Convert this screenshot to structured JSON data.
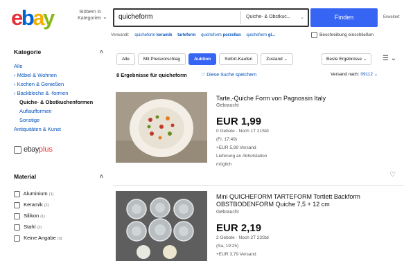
{
  "header": {
    "shop_by": "Stöbern in Kategorien",
    "search_value": "quicheform",
    "category_select": "Quiche- & Obstkuc...",
    "search_button": "Finden",
    "advanced": "Erweitert"
  },
  "related": {
    "prefix": "Verwandt:",
    "items": [
      {
        "pre": "quicheform ",
        "bold": "keramik"
      },
      {
        "pre": "",
        "bold": "tarteform"
      },
      {
        "pre": "quicheform ",
        "bold": "porzellan"
      },
      {
        "pre": "quicheform ",
        "bold": "gl..."
      }
    ],
    "desc_checkbox": "Beschreibung einschließen"
  },
  "sidebar": {
    "category_heading": "Kategorie",
    "categories": [
      {
        "label": "Alle",
        "kind": "link"
      },
      {
        "label": "‹ Möbel & Wohnen",
        "kind": "link"
      },
      {
        "label": "‹ Kochen & Genießen",
        "kind": "link"
      },
      {
        "label": "‹ Backbleche & -formen",
        "kind": "link"
      },
      {
        "label": "Quiche- & Obstkuchenformen",
        "kind": "current"
      },
      {
        "label": "Auflaufformen",
        "kind": "sub"
      },
      {
        "label": "Sonstige",
        "kind": "sub"
      },
      {
        "label": "Antiquitäten & Kunst",
        "kind": "link"
      }
    ],
    "ebayplus_e": "ebay",
    "ebayplus_p": "plus",
    "material_heading": "Material",
    "materials": [
      {
        "label": "Aluminium",
        "count": "(1)"
      },
      {
        "label": "Keramik",
        "count": "(2)"
      },
      {
        "label": "Silikon",
        "count": "(1)"
      },
      {
        "label": "Stahl",
        "count": "(2)"
      },
      {
        "label": "Keine Angabe",
        "count": "(3)"
      }
    ]
  },
  "toolbar": {
    "tabs": [
      "Alle",
      "Mit Preisvorschlag",
      "Auktion",
      "Sofort-Kaufen",
      "Zustand ⌄"
    ],
    "active_tab": "Auktion",
    "sort": "Beste Ergebnisse ⌄",
    "view": "☰ ⌄"
  },
  "results": {
    "count_text": "8 Ergebnisse für ",
    "query": "quicheform",
    "save_search": "Diese Suche speichern",
    "ship_to_label": "Versand nach: ",
    "ship_to_loc": "09112 ⌄"
  },
  "items": [
    {
      "title": "Tarte,-Quiche Form von Pagnossin Italy",
      "condition": "Gebraucht",
      "price": "EUR 1,99",
      "bids": "0 Gebote · Noch 1T 21Std",
      "end": "(Fr, 17:49)",
      "shipping": "+EUR 5,99 Versand",
      "pickup1": "Lieferung an Abholstation",
      "pickup2": "möglich"
    },
    {
      "title": "Mini QUICHEFORM TARTEFORM Tortlett Backform OBSTBODENFORM Quiche 7,5 + 12 cm",
      "condition": "Gebraucht",
      "price": "EUR 2,19",
      "bids": "2 Gebote · Noch 2T 23Std",
      "end": "(Sa, 19:25)",
      "shipping": "+EUR 3,79 Versand"
    }
  ],
  "colors": {
    "accent_blue": "#3665f3",
    "link_blue": "#0654ba",
    "logo_red": "#e53238",
    "logo_blue": "#0064d2",
    "logo_yellow": "#f5af02",
    "logo_green": "#86b817"
  }
}
